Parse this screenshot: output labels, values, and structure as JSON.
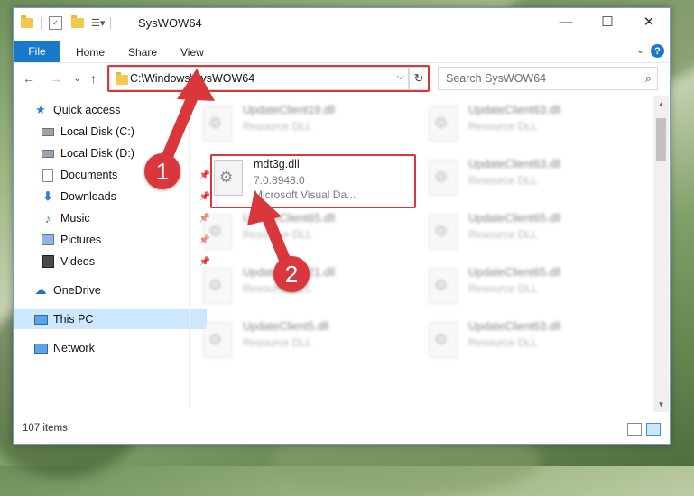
{
  "window": {
    "title": "SysWOW64",
    "controls": {
      "minimize": "—",
      "maximize": "☐",
      "close": "✕"
    }
  },
  "ribbon": {
    "tabs": [
      "File",
      "Home",
      "Share",
      "View"
    ],
    "help": "?"
  },
  "address_bar": {
    "path": "C:\\Windows\\SysWOW64",
    "dropdown": "⌵",
    "refresh": "↻"
  },
  "search": {
    "placeholder": "Search SysWOW64",
    "icon": "search-icon"
  },
  "navigation": {
    "back": "←",
    "forward": "→",
    "recent": "⌄",
    "up": "↑"
  },
  "sidebar": {
    "items": [
      {
        "label": "Quick access",
        "icon": "star-icon"
      },
      {
        "label": "Local Disk (C:)",
        "icon": "drive-icon"
      },
      {
        "label": "Local Disk (D:)",
        "icon": "drive-icon"
      },
      {
        "label": "Documents",
        "icon": "documents-icon"
      },
      {
        "label": "Downloads",
        "icon": "download-icon"
      },
      {
        "label": "Music",
        "icon": "music-icon"
      },
      {
        "label": "Pictures",
        "icon": "pictures-icon"
      },
      {
        "label": "Videos",
        "icon": "videos-icon"
      },
      {
        "label": "OneDrive",
        "icon": "cloud-icon"
      },
      {
        "label": "This PC",
        "icon": "computer-icon"
      },
      {
        "label": "Network",
        "icon": "network-icon"
      }
    ]
  },
  "files": {
    "left": [
      {
        "name": "UpdateClient19.dll",
        "line2": "Resource DLL",
        "line3": ""
      },
      {
        "name": "mdt3g.dll",
        "line2": "7.0.8948.0",
        "line3": "Microsoft Visual Da..."
      },
      {
        "name": "UpdateClient65.dll",
        "line2": "Resource DLL",
        "line3": ""
      },
      {
        "name": "UpdateClient21.dll",
        "line2": "Resource DLL",
        "line3": ""
      },
      {
        "name": "UpdateClient5.dll",
        "line2": "Resource DLL",
        "line3": ""
      }
    ],
    "right": [
      {
        "name": "UpdateClient63.dll",
        "line2": "Resource DLL"
      },
      {
        "name": "UpdateClient63.dll",
        "line2": "Resource DLL"
      },
      {
        "name": "UpdateClient65.dll",
        "line2": "Resource DLL"
      },
      {
        "name": "UpdateClient65.dll",
        "line2": "Resource DLL"
      },
      {
        "name": "UpdateClient63.dll",
        "line2": "Resource DLL"
      }
    ]
  },
  "status": {
    "count": "107 items"
  },
  "annotations": {
    "step1": "1",
    "step2": "2",
    "color": "#d9373c"
  }
}
